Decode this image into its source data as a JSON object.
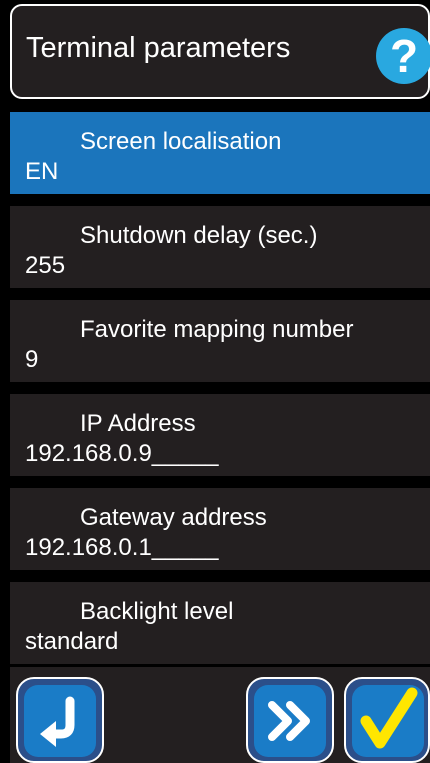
{
  "header": {
    "title": "Terminal parameters",
    "help_glyph": "?",
    "help_icon": "help-icon"
  },
  "parameters": [
    {
      "label": "Screen localisation",
      "value": "EN",
      "selected": true
    },
    {
      "label": "Shutdown delay (sec.)",
      "value": "255",
      "selected": false
    },
    {
      "label": "Favorite mapping number",
      "value": "9",
      "selected": false
    },
    {
      "label": "IP Address",
      "value": "192.168.0.9_____",
      "selected": false
    },
    {
      "label": "Gateway address",
      "value": "192.168.0.1_____",
      "selected": false
    },
    {
      "label": "Backlight level",
      "value": "standard",
      "selected": false
    }
  ],
  "footer": {
    "back_icon": "return-arrow-icon",
    "next_icon": "double-chevron-right-icon",
    "confirm_icon": "checkmark-icon"
  },
  "colors": {
    "background": "#000000",
    "panel": "#231f20",
    "selected": "#1b75bc",
    "help": "#29a8e0",
    "checkmark": "#ffe600"
  }
}
